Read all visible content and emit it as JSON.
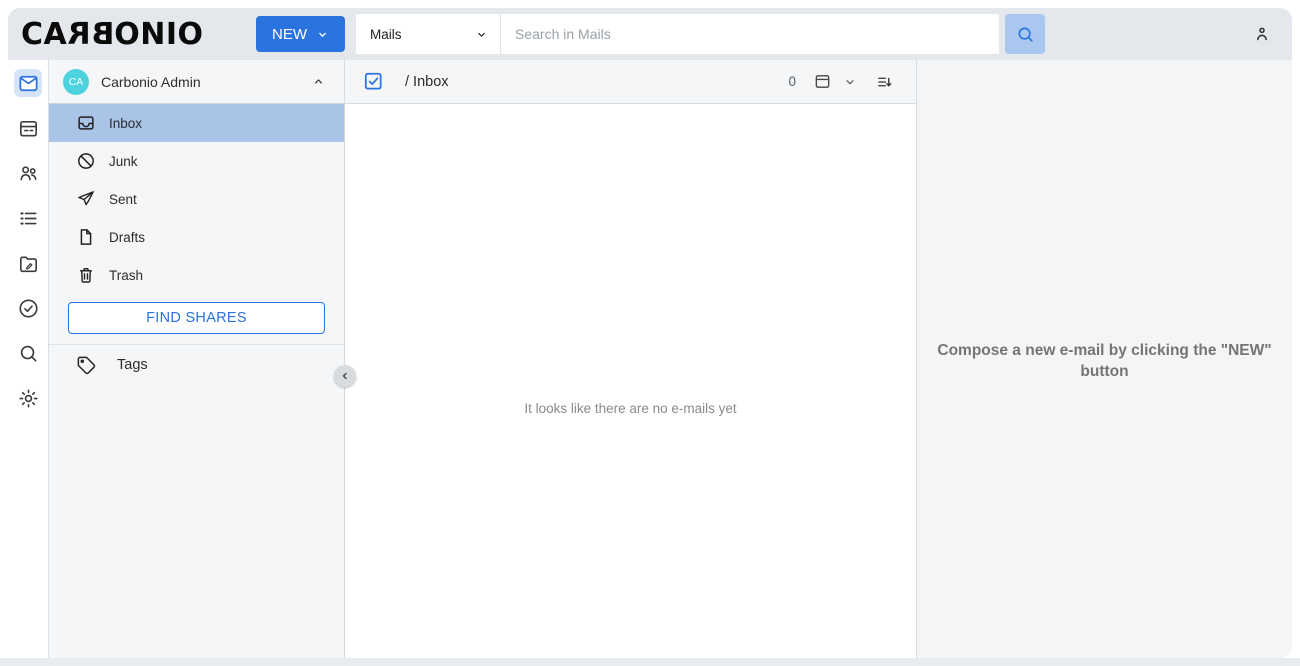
{
  "topbar": {
    "logo": {
      "p1": "CA",
      "p2": "R",
      "p3": "B",
      "p4": "ONIO"
    },
    "new_button_label": "NEW",
    "search": {
      "scope": "Mails",
      "placeholder": "Search in Mails"
    }
  },
  "rail": {
    "items": [
      "mails",
      "calendars",
      "contacts",
      "lists",
      "files",
      "tasks",
      "search",
      "settings"
    ],
    "active_item": "mails"
  },
  "sidebar": {
    "account": {
      "initials": "CA",
      "name": "Carbonio Admin"
    },
    "folders": [
      {
        "label": "Inbox",
        "selected": true
      },
      {
        "label": "Junk",
        "selected": false
      },
      {
        "label": "Sent",
        "selected": false
      },
      {
        "label": "Drafts",
        "selected": false
      },
      {
        "label": "Trash",
        "selected": false
      }
    ],
    "find_shares_label": "FIND SHARES",
    "tags_label": "Tags"
  },
  "list": {
    "breadcrumb": "/ Inbox",
    "count": "0",
    "empty_text": "It looks like there are no e-mails yet"
  },
  "preview": {
    "hint": "Compose a new e-mail by clicking the \"NEW\" button"
  },
  "colors": {
    "accent": "#2b73de",
    "search_button_bg": "#a9c7ef",
    "selected_folder_bg": "#aac4e8",
    "avatar_bg": "#4cd3de",
    "topbar_bg": "#e4e8ec",
    "panel_bg": "#f5f6f8"
  }
}
